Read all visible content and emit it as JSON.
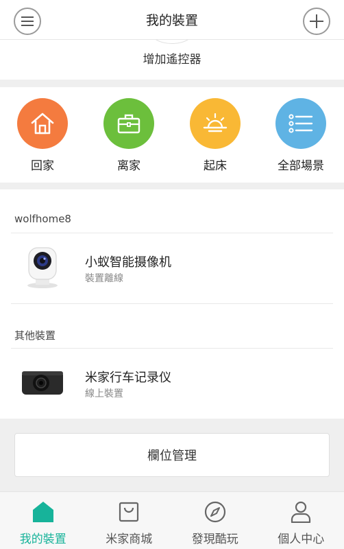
{
  "header": {
    "title": "我的裝置"
  },
  "remote": {
    "label": "增加遙控器"
  },
  "scenes": [
    {
      "label": "回家",
      "color": "#f47b3f",
      "icon": "house-icon"
    },
    {
      "label": "离家",
      "color": "#6cbf3c",
      "icon": "briefcase-icon"
    },
    {
      "label": "起床",
      "color": "#f9b835",
      "icon": "sunrise-icon"
    },
    {
      "label": "全部場景",
      "color": "#5fb3e4",
      "icon": "list-icon"
    }
  ],
  "groups": [
    {
      "title": "wolfhome8",
      "devices": [
        {
          "name": "小蚁智能摄像机",
          "status": "裝置離線",
          "icon": "camera-icon"
        }
      ]
    },
    {
      "title": "其他裝置",
      "devices": [
        {
          "name": "米家行车记录仪",
          "status": "線上裝置",
          "icon": "dashcam-icon"
        }
      ]
    }
  ],
  "manage_button": "欄位管理",
  "tabs": [
    {
      "label": "我的裝置",
      "active": true,
      "icon": "home-icon"
    },
    {
      "label": "米家商城",
      "active": false,
      "icon": "shopping-bag-icon"
    },
    {
      "label": "發現酷玩",
      "active": false,
      "icon": "compass-icon"
    },
    {
      "label": "個人中心",
      "active": false,
      "icon": "person-icon"
    }
  ],
  "colors": {
    "accent": "#17b39a",
    "inactive_tab": "#555555"
  }
}
